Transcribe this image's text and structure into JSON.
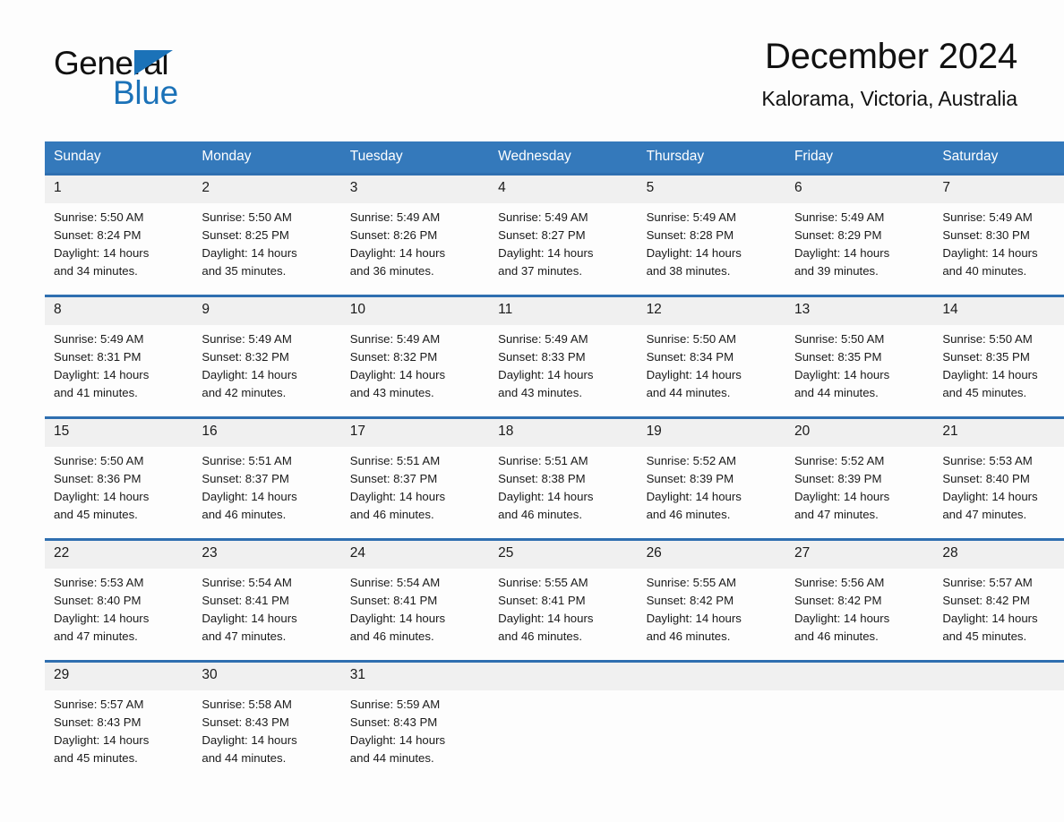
{
  "logo": {
    "word_one": "General",
    "word_two": "Blue",
    "triangle_icon": "blue-triangle-icon",
    "accent_color": "#1b72b8"
  },
  "header": {
    "title": "December 2024",
    "location": "Kalorama, Victoria, Australia"
  },
  "colors": {
    "header_blue": "#3479bb",
    "separator_blue": "#2f6fb0",
    "daynum_band": "#f0f0f0",
    "page_background": "#fdfdfd"
  },
  "calendar": {
    "weekday_headers": [
      "Sunday",
      "Monday",
      "Tuesday",
      "Wednesday",
      "Thursday",
      "Friday",
      "Saturday"
    ],
    "weeks": [
      {
        "days": [
          {
            "date": "1",
            "sunrise": "Sunrise: 5:50 AM",
            "sunset": "Sunset: 8:24 PM",
            "daylight_line1": "Daylight: 14 hours",
            "daylight_line2": "and 34 minutes."
          },
          {
            "date": "2",
            "sunrise": "Sunrise: 5:50 AM",
            "sunset": "Sunset: 8:25 PM",
            "daylight_line1": "Daylight: 14 hours",
            "daylight_line2": "and 35 minutes."
          },
          {
            "date": "3",
            "sunrise": "Sunrise: 5:49 AM",
            "sunset": "Sunset: 8:26 PM",
            "daylight_line1": "Daylight: 14 hours",
            "daylight_line2": "and 36 minutes."
          },
          {
            "date": "4",
            "sunrise": "Sunrise: 5:49 AM",
            "sunset": "Sunset: 8:27 PM",
            "daylight_line1": "Daylight: 14 hours",
            "daylight_line2": "and 37 minutes."
          },
          {
            "date": "5",
            "sunrise": "Sunrise: 5:49 AM",
            "sunset": "Sunset: 8:28 PM",
            "daylight_line1": "Daylight: 14 hours",
            "daylight_line2": "and 38 minutes."
          },
          {
            "date": "6",
            "sunrise": "Sunrise: 5:49 AM",
            "sunset": "Sunset: 8:29 PM",
            "daylight_line1": "Daylight: 14 hours",
            "daylight_line2": "and 39 minutes."
          },
          {
            "date": "7",
            "sunrise": "Sunrise: 5:49 AM",
            "sunset": "Sunset: 8:30 PM",
            "daylight_line1": "Daylight: 14 hours",
            "daylight_line2": "and 40 minutes."
          }
        ]
      },
      {
        "days": [
          {
            "date": "8",
            "sunrise": "Sunrise: 5:49 AM",
            "sunset": "Sunset: 8:31 PM",
            "daylight_line1": "Daylight: 14 hours",
            "daylight_line2": "and 41 minutes."
          },
          {
            "date": "9",
            "sunrise": "Sunrise: 5:49 AM",
            "sunset": "Sunset: 8:32 PM",
            "daylight_line1": "Daylight: 14 hours",
            "daylight_line2": "and 42 minutes."
          },
          {
            "date": "10",
            "sunrise": "Sunrise: 5:49 AM",
            "sunset": "Sunset: 8:32 PM",
            "daylight_line1": "Daylight: 14 hours",
            "daylight_line2": "and 43 minutes."
          },
          {
            "date": "11",
            "sunrise": "Sunrise: 5:49 AM",
            "sunset": "Sunset: 8:33 PM",
            "daylight_line1": "Daylight: 14 hours",
            "daylight_line2": "and 43 minutes."
          },
          {
            "date": "12",
            "sunrise": "Sunrise: 5:50 AM",
            "sunset": "Sunset: 8:34 PM",
            "daylight_line1": "Daylight: 14 hours",
            "daylight_line2": "and 44 minutes."
          },
          {
            "date": "13",
            "sunrise": "Sunrise: 5:50 AM",
            "sunset": "Sunset: 8:35 PM",
            "daylight_line1": "Daylight: 14 hours",
            "daylight_line2": "and 44 minutes."
          },
          {
            "date": "14",
            "sunrise": "Sunrise: 5:50 AM",
            "sunset": "Sunset: 8:35 PM",
            "daylight_line1": "Daylight: 14 hours",
            "daylight_line2": "and 45 minutes."
          }
        ]
      },
      {
        "days": [
          {
            "date": "15",
            "sunrise": "Sunrise: 5:50 AM",
            "sunset": "Sunset: 8:36 PM",
            "daylight_line1": "Daylight: 14 hours",
            "daylight_line2": "and 45 minutes."
          },
          {
            "date": "16",
            "sunrise": "Sunrise: 5:51 AM",
            "sunset": "Sunset: 8:37 PM",
            "daylight_line1": "Daylight: 14 hours",
            "daylight_line2": "and 46 minutes."
          },
          {
            "date": "17",
            "sunrise": "Sunrise: 5:51 AM",
            "sunset": "Sunset: 8:37 PM",
            "daylight_line1": "Daylight: 14 hours",
            "daylight_line2": "and 46 minutes."
          },
          {
            "date": "18",
            "sunrise": "Sunrise: 5:51 AM",
            "sunset": "Sunset: 8:38 PM",
            "daylight_line1": "Daylight: 14 hours",
            "daylight_line2": "and 46 minutes."
          },
          {
            "date": "19",
            "sunrise": "Sunrise: 5:52 AM",
            "sunset": "Sunset: 8:39 PM",
            "daylight_line1": "Daylight: 14 hours",
            "daylight_line2": "and 46 minutes."
          },
          {
            "date": "20",
            "sunrise": "Sunrise: 5:52 AM",
            "sunset": "Sunset: 8:39 PM",
            "daylight_line1": "Daylight: 14 hours",
            "daylight_line2": "and 47 minutes."
          },
          {
            "date": "21",
            "sunrise": "Sunrise: 5:53 AM",
            "sunset": "Sunset: 8:40 PM",
            "daylight_line1": "Daylight: 14 hours",
            "daylight_line2": "and 47 minutes."
          }
        ]
      },
      {
        "days": [
          {
            "date": "22",
            "sunrise": "Sunrise: 5:53 AM",
            "sunset": "Sunset: 8:40 PM",
            "daylight_line1": "Daylight: 14 hours",
            "daylight_line2": "and 47 minutes."
          },
          {
            "date": "23",
            "sunrise": "Sunrise: 5:54 AM",
            "sunset": "Sunset: 8:41 PM",
            "daylight_line1": "Daylight: 14 hours",
            "daylight_line2": "and 47 minutes."
          },
          {
            "date": "24",
            "sunrise": "Sunrise: 5:54 AM",
            "sunset": "Sunset: 8:41 PM",
            "daylight_line1": "Daylight: 14 hours",
            "daylight_line2": "and 46 minutes."
          },
          {
            "date": "25",
            "sunrise": "Sunrise: 5:55 AM",
            "sunset": "Sunset: 8:41 PM",
            "daylight_line1": "Daylight: 14 hours",
            "daylight_line2": "and 46 minutes."
          },
          {
            "date": "26",
            "sunrise": "Sunrise: 5:55 AM",
            "sunset": "Sunset: 8:42 PM",
            "daylight_line1": "Daylight: 14 hours",
            "daylight_line2": "and 46 minutes."
          },
          {
            "date": "27",
            "sunrise": "Sunrise: 5:56 AM",
            "sunset": "Sunset: 8:42 PM",
            "daylight_line1": "Daylight: 14 hours",
            "daylight_line2": "and 46 minutes."
          },
          {
            "date": "28",
            "sunrise": "Sunrise: 5:57 AM",
            "sunset": "Sunset: 8:42 PM",
            "daylight_line1": "Daylight: 14 hours",
            "daylight_line2": "and 45 minutes."
          }
        ]
      },
      {
        "days": [
          {
            "date": "29",
            "sunrise": "Sunrise: 5:57 AM",
            "sunset": "Sunset: 8:43 PM",
            "daylight_line1": "Daylight: 14 hours",
            "daylight_line2": "and 45 minutes."
          },
          {
            "date": "30",
            "sunrise": "Sunrise: 5:58 AM",
            "sunset": "Sunset: 8:43 PM",
            "daylight_line1": "Daylight: 14 hours",
            "daylight_line2": "and 44 minutes."
          },
          {
            "date": "31",
            "sunrise": "Sunrise: 5:59 AM",
            "sunset": "Sunset: 8:43 PM",
            "daylight_line1": "Daylight: 14 hours",
            "daylight_line2": "and 44 minutes."
          },
          {
            "date": "",
            "sunrise": "",
            "sunset": "",
            "daylight_line1": "",
            "daylight_line2": ""
          },
          {
            "date": "",
            "sunrise": "",
            "sunset": "",
            "daylight_line1": "",
            "daylight_line2": ""
          },
          {
            "date": "",
            "sunrise": "",
            "sunset": "",
            "daylight_line1": "",
            "daylight_line2": ""
          },
          {
            "date": "",
            "sunrise": "",
            "sunset": "",
            "daylight_line1": "",
            "daylight_line2": ""
          }
        ]
      }
    ]
  }
}
